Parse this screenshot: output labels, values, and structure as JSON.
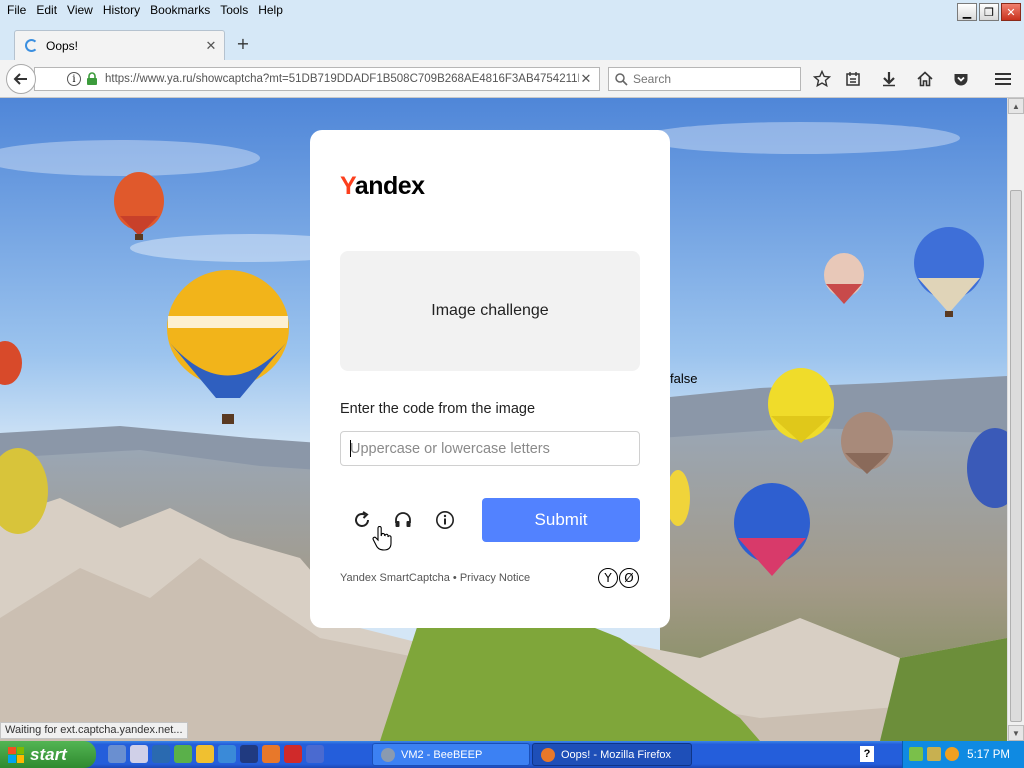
{
  "menu": [
    "File",
    "Edit",
    "View",
    "History",
    "Bookmarks",
    "Tools",
    "Help"
  ],
  "tab": {
    "title": "Oops!"
  },
  "address": {
    "url": "https://www.ya.ru/showcaptcha?mt=51DB719DDADF1B508C709B268AE4816F3AB4754211B2"
  },
  "search": {
    "placeholder": "Search"
  },
  "captcha": {
    "logo_first": "Y",
    "logo_rest": "andex",
    "challenge_label": "Image challenge",
    "prompt": "Enter the code from the image",
    "input_placeholder": "Uppercase or lowercase letters",
    "submit": "Submit",
    "footer": "Yandex SmartCaptcha • Privacy Notice",
    "footer_logo": [
      "Y",
      "Ø"
    ]
  },
  "stray_text": "false",
  "status_text": "Waiting for ext.captcha.yandex.net...",
  "taskbar": {
    "start": "start",
    "tasks": [
      "VM2 - BeeBEEP",
      "Oops! - Mozilla Firefox"
    ],
    "clock": "5:17 PM",
    "tray_help": "?"
  },
  "colors": {
    "yandex_red": "#fc3f1d",
    "submit_blue": "#5282ff",
    "taskbar_blue": "#245edb"
  }
}
